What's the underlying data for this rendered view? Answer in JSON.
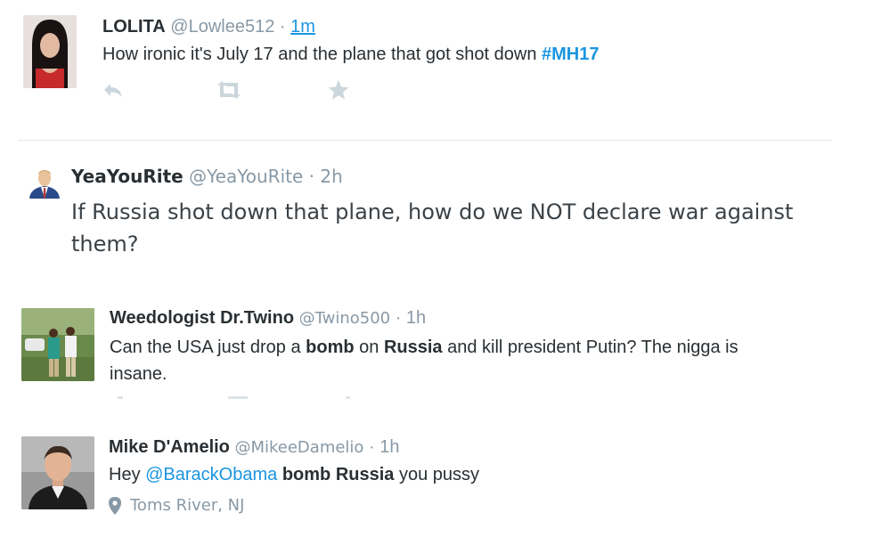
{
  "tweets": [
    {
      "name": "LOLITA",
      "handle": "@Lowlee512",
      "separator": "·",
      "time": "1m",
      "text_before": "How ironic it's July 17 and the plane that got shot down ",
      "hashtag": "#MH17"
    },
    {
      "name": "YeaYouRite",
      "handle": "@YeaYouRite",
      "separator": "·",
      "time": "2h",
      "text_line1": "If Russia shot down that plane, how do we NOT declare war against",
      "text_line2": "them?"
    },
    {
      "name": "Weedologist Dr.Twino",
      "handle": "@Twino500",
      "separator": "·",
      "time": "1h",
      "text_a": "Can the USA just drop a ",
      "text_bold_a": "bomb",
      "text_b": " on ",
      "text_bold_b": "Russia",
      "text_c": " and kill president Putin? The nigga is",
      "text_line2": "insane."
    },
    {
      "name": "Mike D'Amelio",
      "handle": "@MikeeDamelio",
      "separator": "·",
      "time": "1h",
      "text_a": "Hey ",
      "mention": "@BarackObama",
      "text_b": " ",
      "text_bold": "bomb Russia",
      "text_c": " you pussy",
      "location": "Toms River, NJ"
    }
  ],
  "icons": {
    "reply": "reply-icon",
    "retweet": "retweet-icon",
    "favorite": "star-icon",
    "location": "map-pin-icon"
  },
  "colors": {
    "link": "#1b95e0",
    "meta": "#8899a6",
    "action": "#ccd6dd",
    "text": "#292f33"
  }
}
